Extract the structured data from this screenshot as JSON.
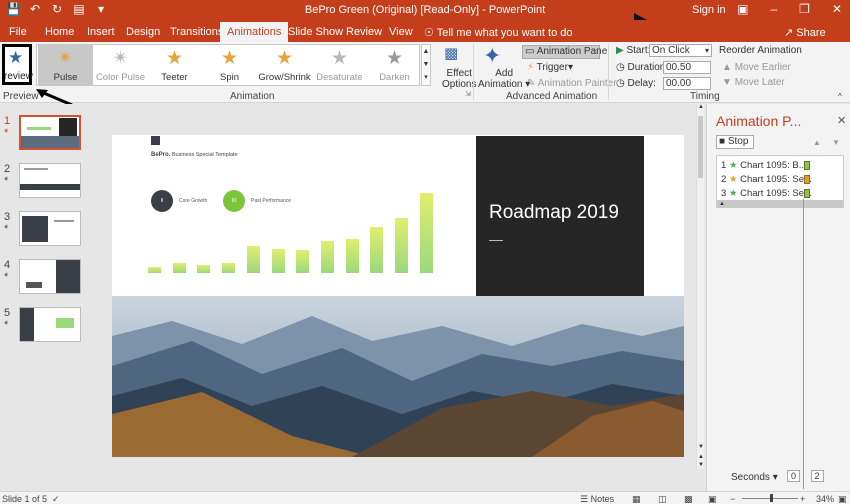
{
  "app": {
    "title": "BePro Green (Original) [Read-Only]  -  PowerPoint",
    "sign_in": "Sign in",
    "share": "Share",
    "qat": [
      "save-icon",
      "undo-icon",
      "redo-icon",
      "customize-icon",
      "more-icon"
    ],
    "window_controls": [
      "ribbon-display-icon",
      "minimize-icon",
      "restore-icon",
      "close-icon"
    ]
  },
  "tabs": [
    "File",
    "Home",
    "Insert",
    "Design",
    "Transitions",
    "Animations",
    "Slide Show",
    "Review",
    "View"
  ],
  "active_tab": "Animations",
  "tell_me": "Tell me what you want to do",
  "ribbon": {
    "preview": {
      "label": "review",
      "group": "Preview"
    },
    "animations": [
      {
        "name": "Pulse",
        "enabled": true,
        "selected": true,
        "color": "#e8a33b"
      },
      {
        "name": "Color Pulse",
        "enabled": false,
        "color": "#b0b0b0"
      },
      {
        "name": "Teeter",
        "enabled": true,
        "color": "#e8a33b"
      },
      {
        "name": "Spin",
        "enabled": true,
        "color": "#e8a33b"
      },
      {
        "name": "Grow/Shrink",
        "enabled": true,
        "color": "#e8a33b"
      },
      {
        "name": "Desaturate",
        "enabled": false,
        "color": "#b0b0b0"
      },
      {
        "name": "Darken",
        "enabled": false,
        "color": "#b0b0b0"
      }
    ],
    "effect_options": [
      "Effect",
      "Options"
    ],
    "animation_group": "Animation",
    "add_animation": [
      "Add",
      "Animation"
    ],
    "animation_pane": "Animation Pane",
    "trigger": "Trigger",
    "animation_painter": "Animation Painter",
    "advanced_group": "Advanced Animation",
    "timing": {
      "start_label": "Start:",
      "start_value": "On Click",
      "duration_label": "Duration:",
      "duration_value": "00.50",
      "delay_label": "Delay:",
      "delay_value": "00.00",
      "reorder": "Reorder Animation",
      "move_earlier": "Move Earlier",
      "move_later": "Move Later",
      "group": "Timing"
    }
  },
  "slides": [
    {
      "num": "1"
    },
    {
      "num": "2"
    },
    {
      "num": "3"
    },
    {
      "num": "4"
    },
    {
      "num": "5"
    }
  ],
  "current_slide": {
    "brand_name": "BePro.",
    "brand_tag": "Business Special Template",
    "legend": [
      {
        "label": "Core Growth",
        "mark": "II",
        "color": "#3a3e47"
      },
      {
        "label": "Past Performance",
        "mark": "III",
        "color": "#7cc43a"
      }
    ],
    "bar_values": [
      5,
      9,
      7,
      9,
      24,
      21,
      20,
      28,
      30,
      40,
      48,
      70
    ],
    "title": "Roadmap 2019"
  },
  "animation_pane": {
    "title": "Animation P...",
    "stop": "Stop",
    "items": [
      {
        "num": "1",
        "label": "Chart 1095: B...",
        "color": "#4caf50"
      },
      {
        "num": "2",
        "label": "Chart 1095: Se...",
        "color": "#e0a020"
      },
      {
        "num": "3",
        "label": "Chart 1095: Se...",
        "color": "#4caf50"
      }
    ],
    "seconds": "Seconds",
    "timeline_start": "0",
    "timeline_end": "2"
  },
  "status": {
    "slide_info": "Slide 1 of 5",
    "notes": "Notes",
    "zoom": "34%"
  }
}
